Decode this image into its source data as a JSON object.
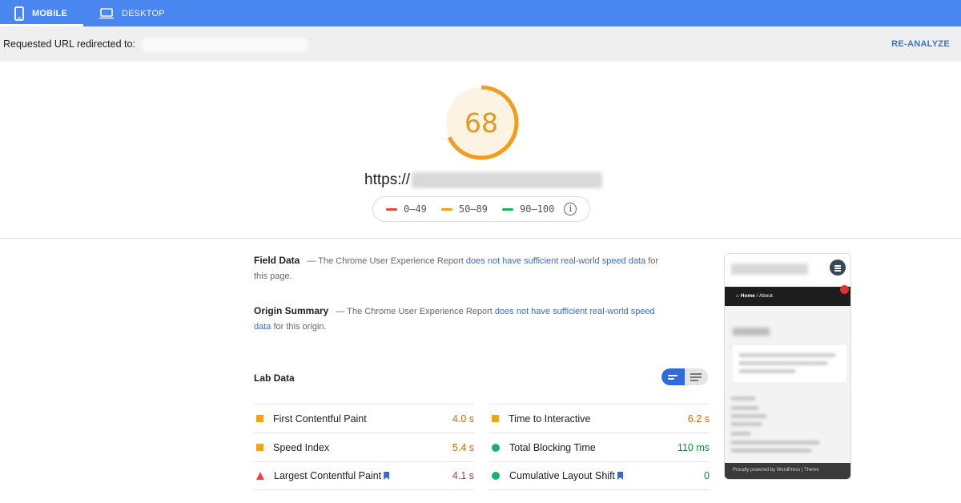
{
  "tabs": [
    {
      "label": "MOBILE",
      "icon": "smartphone-icon"
    },
    {
      "label": "DESKTOP",
      "icon": "monitor-icon"
    }
  ],
  "url_bar": {
    "label": "Requested URL redirected to:",
    "reanalyze": "RE-ANALYZE"
  },
  "score": {
    "value": "68",
    "fraction": 0.68,
    "color": "#f29d1c"
  },
  "page_url": {
    "prefix": "https://"
  },
  "legend": [
    {
      "range": "0–49",
      "color": "#e5483b"
    },
    {
      "range": "50–89",
      "color": "#f2a11b"
    },
    {
      "range": "90–100",
      "color": "#15b566"
    }
  ],
  "field_data": {
    "heading": "Field Data",
    "pre": "— The Chrome User Experience Report ",
    "link": "does not have sufficient real-world speed data",
    "post": " for this page."
  },
  "origin_summary": {
    "heading": "Origin Summary",
    "pre": "— The Chrome User Experience Report ",
    "link": "does not have sufficient real-world speed data",
    "post": " for this origin."
  },
  "lab_data": {
    "heading": "Lab Data"
  },
  "metrics_left": [
    {
      "name": "First Contentful Paint",
      "value": "4.0 s",
      "status": "average"
    },
    {
      "name": "Speed Index",
      "value": "5.4 s",
      "status": "average"
    },
    {
      "name": "Largest Contentful Paint",
      "value": "4.1 s",
      "status": "fail"
    }
  ],
  "metrics_right": [
    {
      "name": "Time to Interactive",
      "value": "6.2 s",
      "status": "average"
    },
    {
      "name": "Total Blocking Time",
      "value": "110 ms",
      "status": "pass"
    },
    {
      "name": "Cumulative Layout Shift",
      "value": "0",
      "status": "pass"
    }
  ],
  "thumbnail": {
    "breadcrumb_home": "Home",
    "breadcrumb_sep": " / ",
    "breadcrumb_page": "About",
    "footer": "Proudly powered by WordPress | Theme"
  }
}
